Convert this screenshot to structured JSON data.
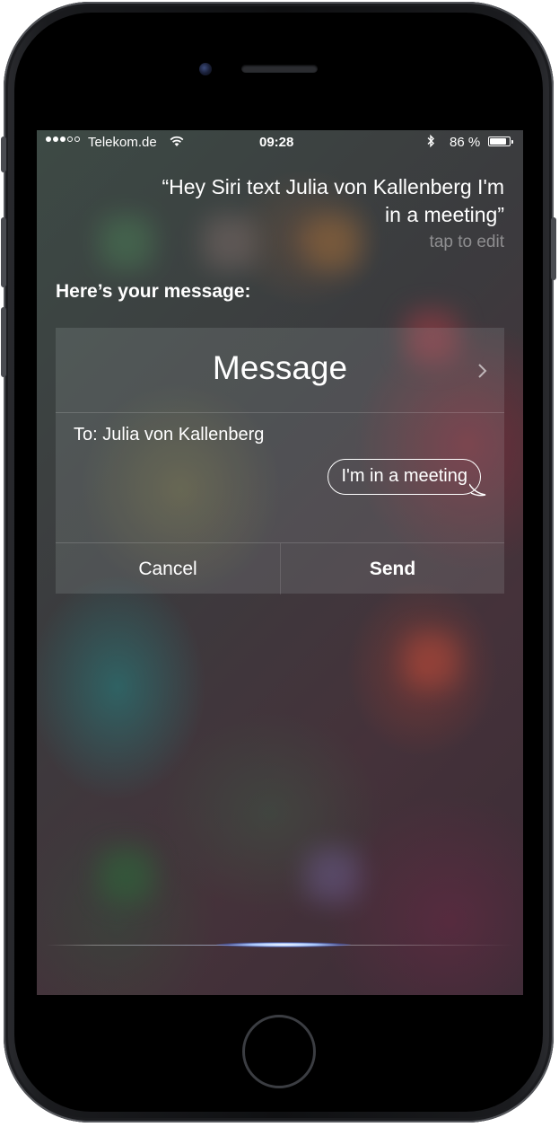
{
  "status_bar": {
    "carrier": "Telekom.de",
    "time": "09:28",
    "battery_percent": "86 %",
    "battery_level": 0.86,
    "signal_bars_filled": 3,
    "signal_bars_total": 5
  },
  "siri": {
    "query_line1": "“Hey Siri text Julia von Kallenberg I'm",
    "query_line2": "in a meeting”",
    "tap_to_edit": "tap to edit",
    "prompt": "Here’s your message:"
  },
  "card": {
    "title": "Message",
    "to": "To: Julia von Kallenberg",
    "message": "I'm in a meeting",
    "cancel_label": "Cancel",
    "send_label": "Send"
  },
  "colors": {
    "text": "#ffffff",
    "muted_text": "#8a7f86"
  },
  "icons": {
    "wifi": "wifi-icon",
    "bluetooth": "bluetooth-icon",
    "battery": "battery-icon",
    "chevron": "chevron-right-icon"
  }
}
